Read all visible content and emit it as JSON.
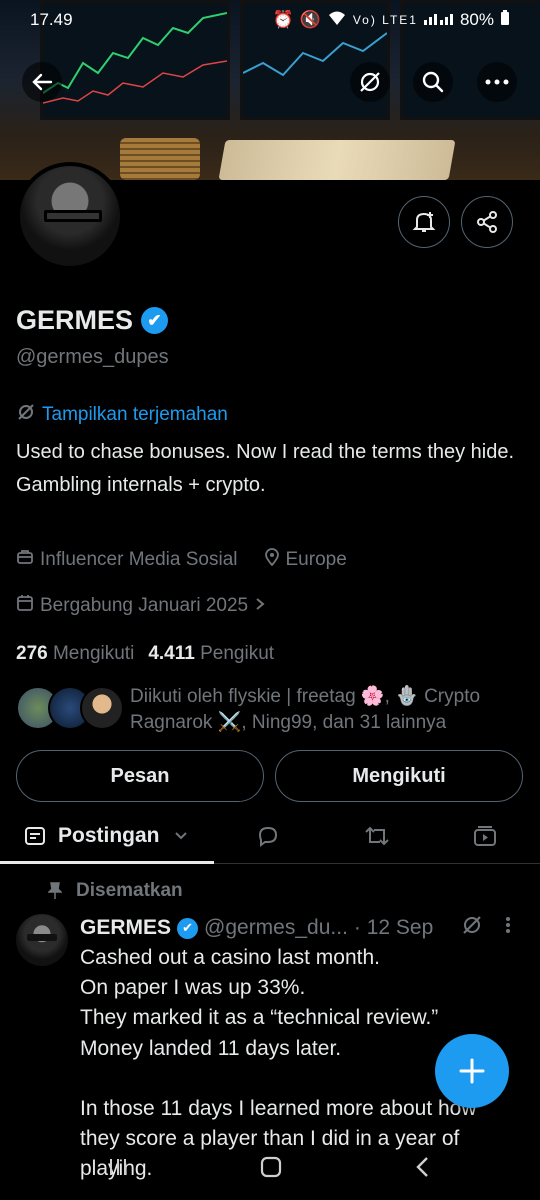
{
  "status_bar": {
    "time": "17.49",
    "battery": "80%",
    "network": "Vo) LTE1"
  },
  "top_nav": {
    "back_icon": "arrow-left-icon",
    "translate_icon": "translate-off-icon",
    "search_icon": "search-icon",
    "more_icon": "more-horizontal-icon"
  },
  "profile": {
    "name": "GERMES",
    "handle": "@germes_dupes",
    "translate_link": "Tampilkan terjemahan",
    "bio_lines": [
      "Used to chase bonuses. Now I read the terms they hide.",
      "Gambling internals + crypto."
    ],
    "category": "Influencer Media Sosial",
    "location": "Europe",
    "joined": "Bergabung Januari 2025",
    "following_count": "276",
    "following_label": "Mengikuti",
    "followers_count": "4.411",
    "followers_label": "Pengikut",
    "followed_by": "Diikuti oleh flyskie | freetag 🌸, 🪬 Crypto Ragnarok ⚔️, Ning99, dan 31 lainnya"
  },
  "buttons": {
    "message": "Pesan",
    "following": "Mengikuti"
  },
  "tabs": {
    "posts": "Postingan"
  },
  "pinned_post": {
    "pinned_label": "Disematkan",
    "author_name": "GERMES",
    "author_handle": "@germes_du...",
    "date": "· 12 Sep",
    "text": "Cashed out a casino last month.\nOn paper I was up 33%.\nThey marked it as a “technical review.”\nMoney landed 11 days later.\n\nIn those 11 days I learned more about how they score a player than I did in a year of playing."
  },
  "colors": {
    "accent": "#1d9bf0",
    "background": "#000000",
    "muted": "#71767b",
    "text": "#e7e9ea"
  }
}
